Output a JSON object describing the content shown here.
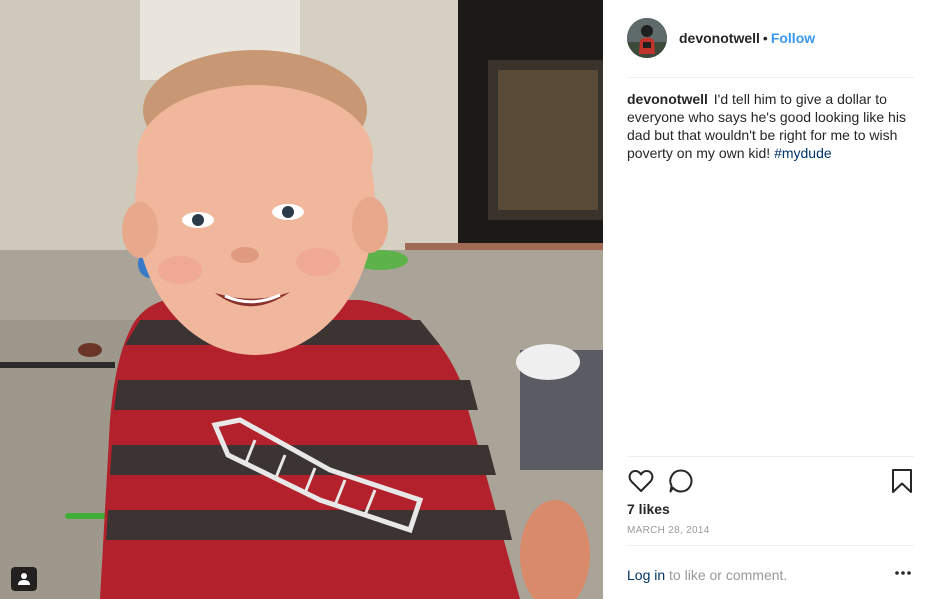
{
  "post": {
    "username": "devonotwell",
    "separator": "•",
    "follow_label": "Follow",
    "caption_text": "I'd tell him to give a dollar to everyone who says he's good looking like his dad but that wouldn't be right for me to wish poverty on my own kid!",
    "hashtag": "#mydude",
    "likes": "7 likes",
    "date": "MARCH 28, 2014",
    "login_link": "Log in",
    "login_rest": "to like or comment."
  },
  "icons": {
    "like": "heart-outline-icon",
    "comment": "speech-bubble-icon",
    "save": "bookmark-icon",
    "more": "ellipsis-icon",
    "user_tag": "person-icon"
  },
  "colors": {
    "link_blue": "#3897f0",
    "hashtag_navy": "#003569",
    "muted_gray": "#999999",
    "divider": "#efefef"
  }
}
